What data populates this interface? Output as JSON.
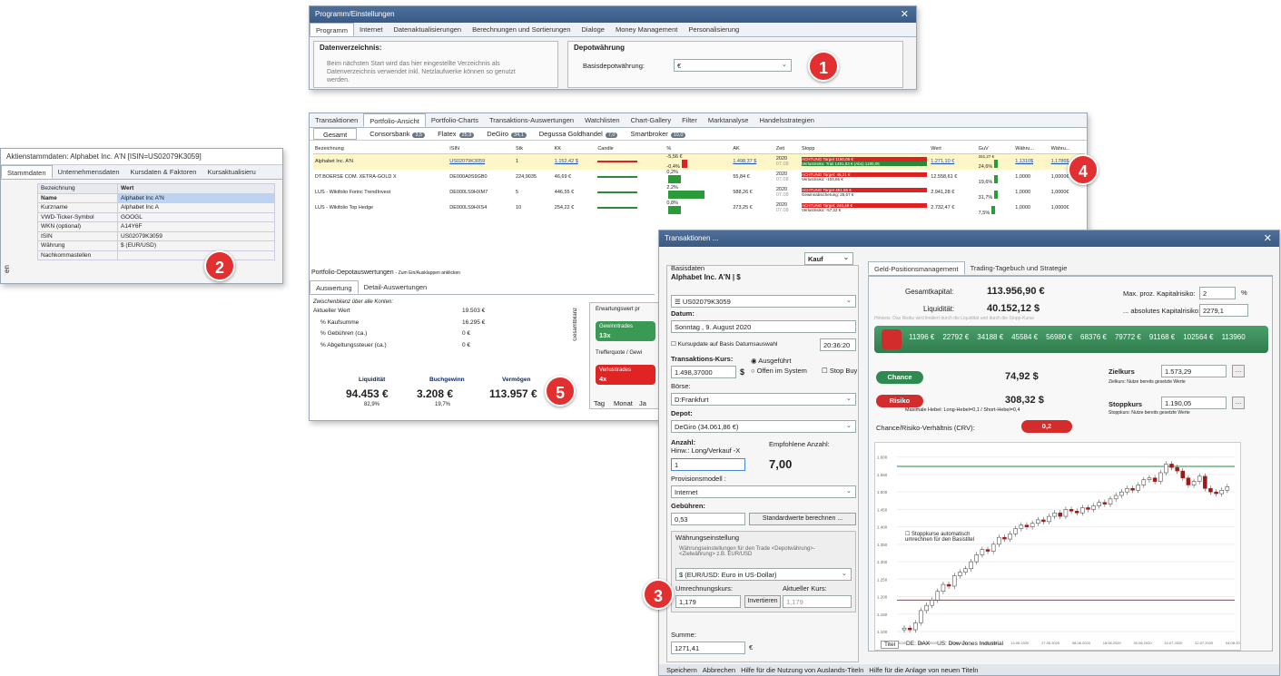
{
  "settings": {
    "title": "Programm/Einstellungen",
    "close": "✕",
    "tabs": [
      "Programm",
      "Internet",
      "Datenaktualisierungen",
      "Berechnungen und Sortierungen",
      "Dialoge",
      "Money Management",
      "Personalisierung"
    ],
    "data_dir_title": "Datenverzeichnis:",
    "data_dir_text": "Beim nächsten Start wird das hier eingestellte Verzeichnis als Datenverzeichnis verwendet inkl. Netzlaufwerke können so genutzt werden.",
    "depot_title": "Depotwährung",
    "base_label": "Basisdepotwährung:",
    "base_value": "€"
  },
  "badges": [
    "1",
    "2",
    "3",
    "4",
    "5"
  ],
  "master": {
    "title": "Aktienstammdaten: Alphabet Inc. A'N [ISIN=US02079K3059]",
    "tabs": [
      "Stammdaten",
      "Unternehmensdaten",
      "Kursdaten & Faktoren",
      "Kursaktualisieru"
    ],
    "header": [
      "Bezeichnung",
      "Wert"
    ],
    "rows": [
      [
        "Name",
        "Alphabet Inc A'N"
      ],
      [
        "Kurzname",
        "Alphabet Inc A"
      ],
      [
        "VWD-Ticker-Symbol",
        "GOOGL"
      ],
      [
        "WKN (optional)",
        "A14Y6F"
      ],
      [
        "ISIN",
        "US02079K3059"
      ],
      [
        "Währung",
        "$ (EUR/USD)"
      ],
      [
        "Nachkommastellen",
        ""
      ]
    ],
    "side": "en"
  },
  "portfolio": {
    "menu": [
      "Transaktionen",
      "Portfolio-Ansicht",
      "Portfolio-Charts",
      "Transaktions-Auswertungen",
      "Watchlisten",
      "Chart-Gallery",
      "Filter",
      "Marktanalyse",
      "Handelsstrategien"
    ],
    "tabs": [
      {
        "l": "Gesamt",
        "b": ""
      },
      {
        "l": "Consorsbank",
        "b": "3,5"
      },
      {
        "l": "Flatex",
        "b": "25,9"
      },
      {
        "l": "DeGiro",
        "b": "34,1"
      },
      {
        "l": "Degussa Goldhandel",
        "b": "7,0"
      },
      {
        "l": "Smartbroker",
        "b": "10,0"
      }
    ],
    "cols": [
      "Bezeichnung",
      "ISIN",
      "Stk",
      "KK",
      "Candle",
      "%",
      "AK",
      "Zeit",
      "Stopp",
      "Wert",
      "GuV",
      "Währu...",
      "Währu..."
    ],
    "rows": [
      {
        "name": "Alphabet Inc. A'N",
        "isin": "US02079K3059",
        "stk": "1",
        "kk": "1.152,42 $",
        "pct1": "-5,56 €",
        "pct2": "-0,4%",
        "ak": "1.498,37 $",
        "z1": "2020",
        "z2": "07.08",
        "stop1": "ACHTUNG Target 1190,05 €",
        "stop2": "Verlustrisiko: Trail 1491,83 € (Abs) 1190,05",
        "wert": "1.271,10 €",
        "g1": "251,27 €",
        "g2": "24,6%",
        "w1": "1,1310$",
        "w2": "1,1786$"
      },
      {
        "name": "DT.BOERSE COM. XETRA-GOLD X",
        "isin": "DE000A0S9GB0",
        "stk": "224,9035",
        "kk": "46,69 €",
        "pct1": "0,2%",
        "pct2": "",
        "ak": "55,84 €",
        "z1": "2020",
        "z2": "07.08",
        "stop1": "ACHTUNG Target: 46,21 €",
        "stop2": "Verlustrisiko: -104,65 €",
        "wert": "12.558,61 €",
        "g1": "",
        "g2": "19,6%",
        "w1": "1,0000",
        "w2": "1,0000€"
      },
      {
        "name": "LUS - Wikifolio Forinc TrendInvest",
        "isin": "DE000LS9HXM7",
        "stk": "5",
        "kk": "446,55 €",
        "pct1": "2,2%",
        "pct2": "",
        "ak": "588,26 €",
        "z1": "2020",
        "z2": "07.08",
        "stop1": "ACHTUNG Target 451,56 €",
        "stop2": "Gewinnabsicherung: 25,67 €",
        "wert": "2.941,28 €",
        "g1": "",
        "g2": "31,7%",
        "w1": "1,0000",
        "w2": "1,0000€"
      },
      {
        "name": "LUS - Wikifolio Top Hedge",
        "isin": "DE000LS9HXS4",
        "stk": "10",
        "kk": "254,22 €",
        "pct1": "0,8%",
        "pct2": "",
        "ak": "273,25 €",
        "z1": "2020",
        "z2": "07.08",
        "stop1": "ACHTUNG Target: 240,49 €",
        "stop2": "Verlustrisiko: -57,22 €",
        "wert": "2.732,47 €",
        "g1": "",
        "g2": "7,5%",
        "w1": "1,0000",
        "w2": "1,0000€"
      }
    ],
    "eval_title": "Portfolio-Depotauswertungen",
    "eval_hint": "- Zum Ein/Ausklappen anklicken",
    "eval_tabs": [
      "Auswertung",
      "Detail-Auswertungen"
    ],
    "bal_title": "Zwischenbilanz über alle Konten:",
    "bal": [
      [
        "Aktueller Wert",
        "19.503 €"
      ],
      [
        "% Kaufsumme",
        "16.295 €"
      ],
      [
        "% Gebühren (ca.)",
        "0 €"
      ],
      [
        "% Abgeltungssteuer (ca.)",
        "0 €"
      ]
    ],
    "sums": [
      {
        "l": "Liquidität",
        "v": "94.453 €",
        "p": "82,9%"
      },
      {
        "l": "Buchgewinn",
        "v": "3.208 €",
        "p": "19,7%"
      },
      {
        "l": "Vermögen",
        "v": "113.957 €",
        "p": ""
      }
    ],
    "ew": "Erwartungswert pr",
    "gesamt": "Gesamtbilanz",
    "gw": "Gewinntrades",
    "gw_n": "13x",
    "tq": "Trefferquote / Gewi",
    "vl": "Verlusttrades",
    "vl_n": "4x",
    "time_tabs": [
      "Tag",
      "Monat",
      "Ja"
    ]
  },
  "trans": {
    "title": "Transaktionen ...",
    "close": "✕",
    "mode": "Kauf",
    "basis": "Basisdaten",
    "stock": "Alphabet Inc. A'N | $",
    "isin": "US02079K3059",
    "datum_l": "Datum:",
    "datum": "Sonntag ,  9.  August  2020",
    "time": "20:36:20",
    "kursupdate": "Kursupdate auf Basis Datumsauswahl",
    "tk_l": "Transaktions-Kurs:",
    "tk": "1.498,37000",
    "cur": "$",
    "r1": "Ausgeführt",
    "r2": "Offen im System",
    "r3": "Stop Buy",
    "boerse_l": "Börse:",
    "boerse": "D:Frankfurt",
    "depot_l": "Depot:",
    "depot": "DeGiro (34.061,86 €)",
    "anz_l": "Anzahl:",
    "anz_hint": "Hinw.: Long/Verkauf -X",
    "emp_l": "Empfohlene Anzahl:",
    "emp": "7,00",
    "anz": "1",
    "prov_l": "Provisionsmodell :",
    "prov": "Internet",
    "geb_l": "Gebühren:",
    "geb": "0,53",
    "std": "Standardwerte berechnen ...",
    "we_l": "Währungseinstellung",
    "we_hint": "Währungseinstellungen für den Trade <Depotwährung>-<Zielwährung> z.B. EUR/USD",
    "we": "$ (EUR/USD: Euro in US-Dollar)",
    "uk_l": "Umrechnungskurs:",
    "ak_l": "Aktueller Kurs:",
    "uk": "1,179",
    "inv": "Invertieren",
    "ak": "1,179",
    "sum_l": "Summe:",
    "sum": "1271,41",
    "sum_c": "€",
    "rtabs": [
      "Geld-Positionsmanagement",
      "Trading-Tagebuch und Strategie"
    ],
    "gk_l": "Gesamtkapital:",
    "gk": "113.956,90 €",
    "liq_l": "Liquidität:",
    "liq": "40.152,12 $",
    "hint": "Hinweis: Das Risiko wird limitiert durch die Liquidität und durch die Stopp-Kurse",
    "mk_l": "Max. proz. Kapitalrisiko:",
    "mk": "2",
    "mk_u": "%",
    "abs_l": "... absolutes Kapitalrisiko:",
    "abs": "2279,1",
    "scale": [
      "11396 €",
      "22792 €",
      "34188 €",
      "45584 €",
      "56980 €",
      "68376 €",
      "79772 €",
      "91168 €",
      "102564 €",
      "113960"
    ],
    "chance": "Chance",
    "chance_v": "74,92 $",
    "risiko": "Risiko",
    "risiko_v": "308,32 $",
    "hebel": "Maximale Hebel: Long-Hebel=0,1 / Short-Hebel=0,4",
    "ziel_l": "Zielkurs",
    "ziel": "1.573,29",
    "ziel_h": "Zielkurs: Nutze bereits gesetzte Werte",
    "stopp_l": "Stoppkurs",
    "stopp": "1.190,05",
    "stopp_h": "Stoppkurs: Nutze bereits gesetzte Werte",
    "crv_l": "Chance/Risiko-Verhältnis (CRV):",
    "crv": "0,2",
    "conv": "Stoppkurse automatisch umrechnen für den Basistitel",
    "ctabs": [
      "Titel",
      "DE: DAX",
      "US: Dow Jones Industrial"
    ],
    "foot": [
      "Speichern",
      "Abbrechen",
      "Hilfe für die Nutzung von Auslands-Titeln",
      "Hilfe für die Anlage von neuen Titeln"
    ],
    "yt": [
      "1.600",
      "1.550",
      "1.500",
      "1.450",
      "1.400",
      "1.350",
      "1.300",
      "1.250",
      "1.200",
      "1.150",
      "1.100"
    ],
    "xt": [
      "01.03.2020",
      "09.04.2020",
      "22.04.2020",
      "04.05.2020",
      "14.05.2020",
      "27.05.2020",
      "08.06.2020",
      "18.06.2020",
      "30.06.2020",
      "10.07.2020",
      "22.07.2020",
      "04.08.2020"
    ]
  },
  "chart_data": {
    "type": "candlestick",
    "ylim": [
      1100,
      1620
    ],
    "target_line": 1573.29,
    "stop_line": 1190.05,
    "closes": [
      1110,
      1105,
      1125,
      1160,
      1175,
      1190,
      1215,
      1235,
      1230,
      1260,
      1270,
      1280,
      1300,
      1320,
      1335,
      1330,
      1350,
      1370,
      1365,
      1380,
      1395,
      1405,
      1400,
      1410,
      1420,
      1415,
      1430,
      1440,
      1430,
      1450,
      1445,
      1440,
      1455,
      1450,
      1460,
      1470,
      1465,
      1480,
      1490,
      1500,
      1510,
      1505,
      1520,
      1535,
      1540,
      1530,
      1555,
      1580,
      1570,
      1560,
      1540,
      1520,
      1530,
      1545,
      1510,
      1500,
      1495,
      1505,
      1515
    ]
  }
}
